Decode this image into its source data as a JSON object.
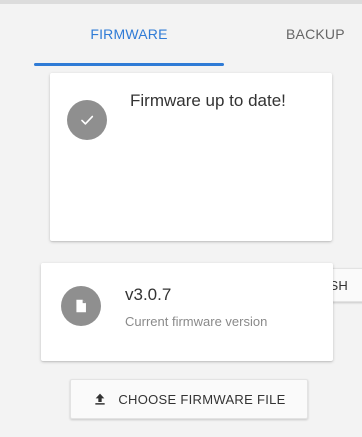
{
  "tabs": {
    "firmware": "FIRMWARE",
    "backup": "BACKUP",
    "active": "firmware"
  },
  "status_card": {
    "title": "Firmware up to date!",
    "icon": "check-circle-icon",
    "refresh_label": "REFRESH"
  },
  "version_card": {
    "version": "v3.0.7",
    "subtitle": "Current firmware version",
    "icon": "file-icon"
  },
  "choose_button": {
    "label": "CHOOSE FIRMWARE FILE",
    "icon": "upload-icon"
  },
  "colors": {
    "accent": "#2f7bd6",
    "icon_gray": "#8f8f8f",
    "background": "#f3f3f3"
  }
}
